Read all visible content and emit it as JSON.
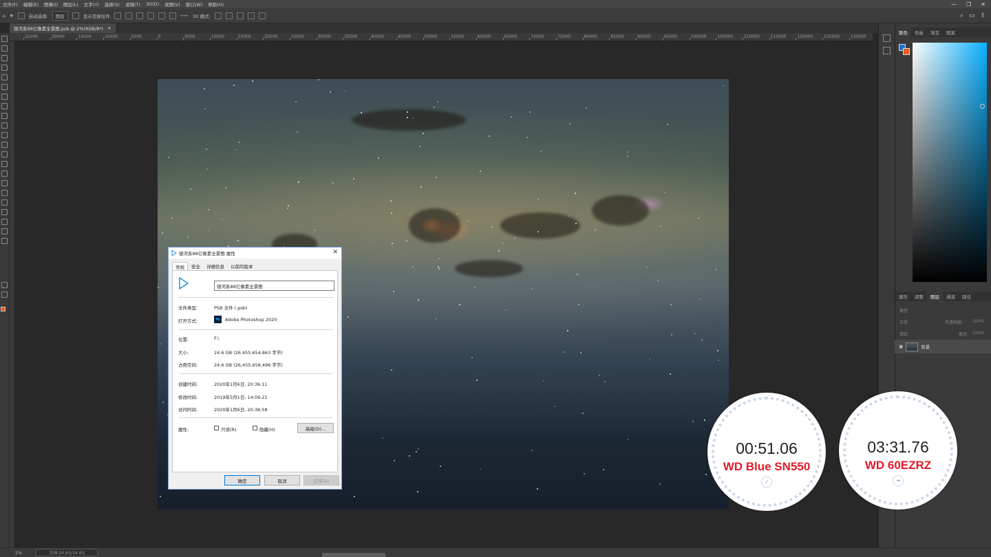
{
  "menu": [
    "文件(F)",
    "编辑(E)",
    "图像(I)",
    "图层(L)",
    "文字(Y)",
    "选择(S)",
    "滤镜(T)",
    "3D(D)",
    "视图(V)",
    "窗口(W)",
    "帮助(H)"
  ],
  "options_bar": {
    "auto_select": "自动选择:",
    "layer_select": "图层",
    "show_transform": "显示变换控件",
    "mode_3d": "3D 模式:"
  },
  "document_tab": {
    "title": "银河系88亿像素全景图.psb @ 2%(RGB/8*)",
    "close": "×"
  },
  "ruler_ticks": [
    "25000",
    "20000",
    "15000",
    "10000",
    "5000",
    "0",
    "5000",
    "10000",
    "15000",
    "20000",
    "25000",
    "30000",
    "35000",
    "40000",
    "45000",
    "50000",
    "55000",
    "60000",
    "65000",
    "70000",
    "75000",
    "80000",
    "85000",
    "90000",
    "95000",
    "100000",
    "105000",
    "110000",
    "115000",
    "120000",
    "125000",
    "130000"
  ],
  "right_panel": {
    "top_tabs": [
      "颜色",
      "色板",
      "渐变",
      "图案"
    ],
    "mid_tabs": [
      "属性",
      "调整",
      "图层",
      "通道",
      "路径"
    ],
    "active_mid_tab": "图层",
    "search_kind": "类型",
    "blend_mode": "正常",
    "opacity_label": "不透明度:",
    "opacity": "100%",
    "lock_label": "锁定:",
    "fill_label": "填充:",
    "fill": "100%",
    "layer_name": "背景",
    "fg_color": "#1e71c9",
    "bg_color": "#e85c1d"
  },
  "status": {
    "zoom": "2%",
    "doc_size": "文档:24.6G/24.6G"
  },
  "dialog": {
    "title": "银河系88亿像素全景图 属性",
    "tabs": [
      "常规",
      "安全",
      "详细信息",
      "以前的版本"
    ],
    "active_tab": "常规",
    "file_name": "银河系88亿像素全景图",
    "rows": {
      "type_label": "文件类型:",
      "type_value": "PSB 文件 (.psb)",
      "open_label": "打开方式:",
      "open_value": "Adobe Photoshop 2020",
      "location_label": "位置:",
      "location_value": "F:\\",
      "size_label": "大小:",
      "size_value": "24.6 GB (26,455,654,863 字节)",
      "disk_label": "占用空间:",
      "disk_value": "24.6 GB (26,455,658,496 字节)",
      "created_label": "创建时间:",
      "created_value": "2020年1月6日, 20:36:11",
      "modified_label": "修改时间:",
      "modified_value": "2019年5月1日, 14:09:21",
      "accessed_label": "访问时间:",
      "accessed_value": "2020年1月6日, 20:38:58",
      "attrs_label": "属性:",
      "readonly": "只读(R)",
      "hidden": "隐藏(H)",
      "advanced": "高级(D)..."
    },
    "buttons": {
      "ok": "确定",
      "cancel": "取消",
      "apply": "应用(A)"
    }
  },
  "timers": [
    {
      "time": "00:51.06",
      "label": "WD Blue SN550"
    },
    {
      "time": "03:31.76",
      "label": "WD 60EZRZ"
    }
  ]
}
